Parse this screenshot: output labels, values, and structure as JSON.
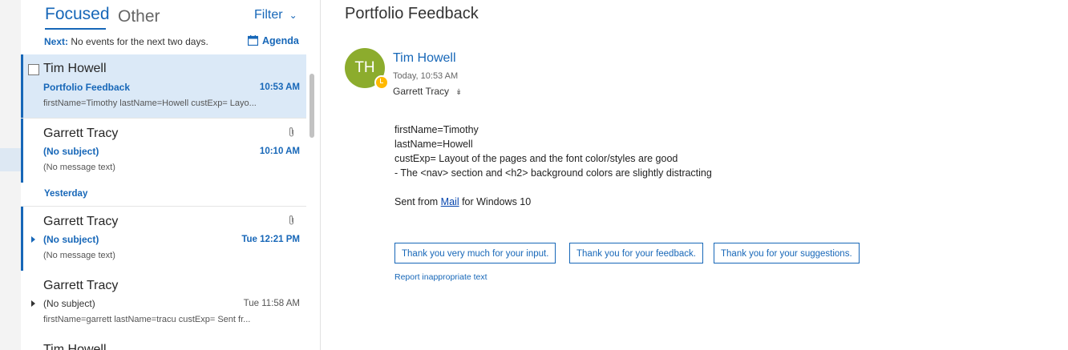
{
  "tabs": {
    "focused": "Focused",
    "other": "Other",
    "filter": "Filter"
  },
  "next": {
    "label": "Next:",
    "text": "No events for the next two days."
  },
  "agenda": {
    "label": "Agenda"
  },
  "messages": [
    {
      "sender": "Tim Howell",
      "subject": "Portfolio Feedback",
      "time": "10:53 AM",
      "preview": "firstName=Timothy lastName=Howell custExp= Layo..."
    },
    {
      "sender": "Garrett Tracy",
      "subject": "(No subject)",
      "time": "10:10 AM",
      "preview": "(No message text)"
    },
    {
      "sender": "Garrett Tracy",
      "subject": "(No subject)",
      "time": "Tue 12:21 PM",
      "preview": "(No message text)"
    },
    {
      "sender": "Garrett Tracy",
      "subject": "(No subject)",
      "time": "Tue 11:58 AM",
      "preview": "firstName=garrett lastName=tracu custExp=  Sent fr..."
    },
    {
      "sender": "Tim Howell"
    }
  ],
  "group_yesterday": "Yesterday",
  "reading": {
    "title": "Portfolio Feedback",
    "avatar_initials": "TH",
    "sender": "Tim Howell",
    "time": "Today, 10:53 AM",
    "to": "Garrett Tracy",
    "body": [
      "firstName=Timothy",
      "lastName=Howell",
      "custExp=  Layout of the pages and the font color/styles are good",
      "- The <nav> section and <h2> background colors are slightly distracting"
    ],
    "signature_prefix": "Sent from ",
    "signature_link": "Mail",
    "signature_suffix": " for Windows 10",
    "suggested_replies": [
      "Thank you very much for your input.",
      "Thank you for your feedback.",
      "Thank you for your suggestions."
    ],
    "report": "Report inappropriate text"
  },
  "colors": {
    "accent": "#1767b8",
    "selected_bg": "#dbe9f7",
    "avatar": "#8cac2d"
  }
}
